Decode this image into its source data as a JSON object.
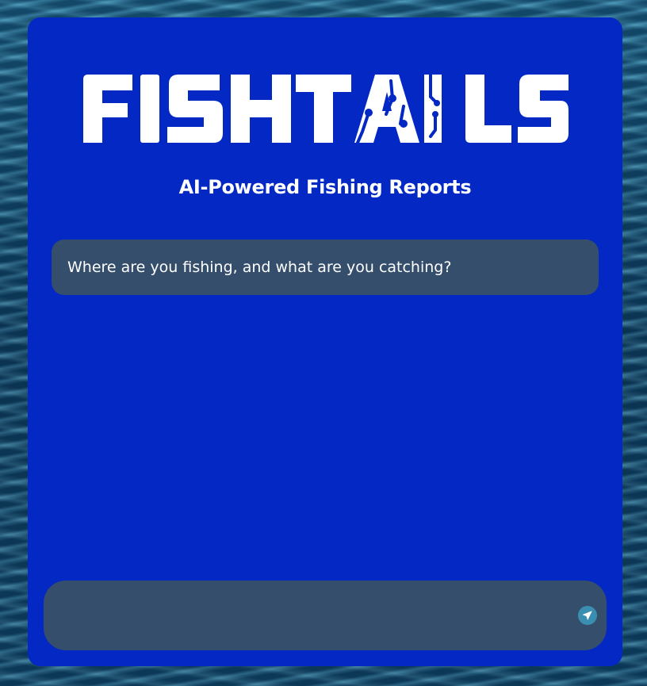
{
  "brand": {
    "logo_text": "FISHTAILS",
    "tagline": "AI-Powered Fishing Reports"
  },
  "chat": {
    "messages": [
      {
        "role": "assistant",
        "text": "Where are you fishing, and what are you catching?"
      }
    ]
  },
  "composer": {
    "value": "",
    "placeholder": "",
    "send_icon": "send-icon"
  },
  "colors": {
    "panel_bg": "#0328c4",
    "bubble_bg": "#344e6b",
    "send_button": "#3a8fb0",
    "text": "#ffffff"
  }
}
